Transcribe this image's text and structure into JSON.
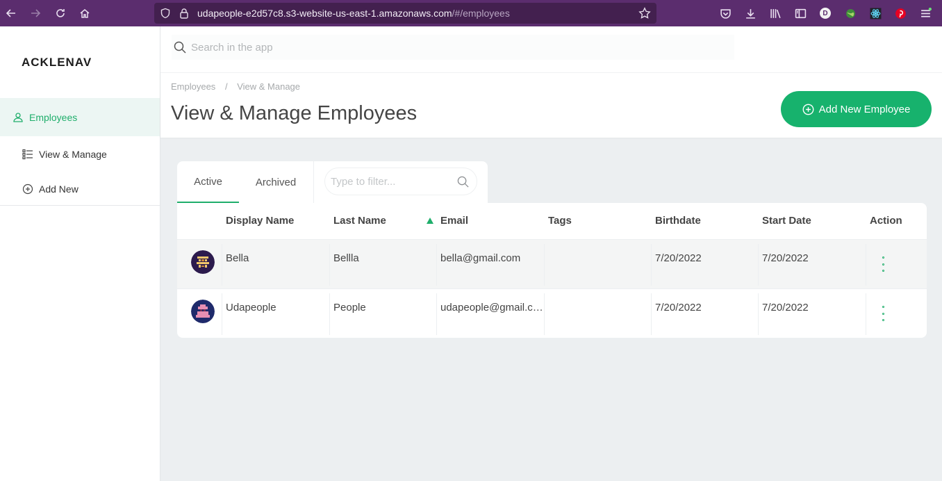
{
  "browser": {
    "url_host": "udapeople-e2d57c8.s3-website-us-east-1.amazonaws.com",
    "url_path": "/#/employees",
    "profile_initial": "D"
  },
  "sidebar": {
    "logo": "ACKLENAVENUE",
    "items": [
      {
        "label": "Employees",
        "icon": "user-icon"
      },
      {
        "label": "View & Manage",
        "icon": "list-icon"
      },
      {
        "label": "Add New",
        "icon": "plus-circle-icon"
      }
    ]
  },
  "search": {
    "placeholder": "Search in the app"
  },
  "header": {
    "breadcrumb": [
      "Employees",
      "View & Manage"
    ],
    "breadcrumb_sep": "/",
    "title": "View & Manage Employees",
    "add_button": "Add New Employee"
  },
  "tabs": {
    "active": "Active",
    "archived": "Archived",
    "filter_placeholder": "Type to filter..."
  },
  "table": {
    "columns": [
      "Display Name",
      "Last Name",
      "Email",
      "Tags",
      "Birthdate",
      "Start Date",
      "Action"
    ],
    "rows": [
      {
        "display_name": "Bella",
        "last_name": "Bellla",
        "email": "bella@gmail.com",
        "tags": "",
        "birthdate": "7/20/2022",
        "start_date": "7/20/2022"
      },
      {
        "display_name": "Udapeople",
        "last_name": "People",
        "email": "udapeople@gmail.c…",
        "tags": "",
        "birthdate": "7/20/2022",
        "start_date": "7/20/2022"
      }
    ]
  },
  "colors": {
    "accent": "#17b26d",
    "browser_bar": "#5b2d6e",
    "background": "#eceff1"
  }
}
